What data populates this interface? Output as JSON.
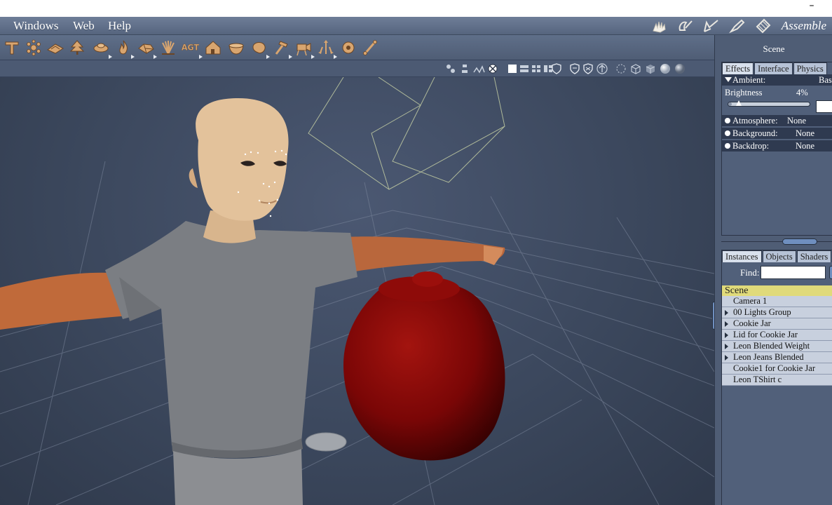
{
  "window": {
    "minimize_glyph": "–"
  },
  "menubar": {
    "items": [
      {
        "label": "Windows"
      },
      {
        "label": "Web"
      },
      {
        "label": "Help"
      }
    ],
    "rooms": {
      "icons": [
        "hand-icon",
        "face-brush-icon",
        "pen-icon",
        "pen-nib-icon",
        "material-room-icon"
      ],
      "current_label": "Assemble"
    }
  },
  "toolbar": {
    "tools": [
      {
        "icon": "text-tool-icon",
        "has_menu": false
      },
      {
        "icon": "sparkle-tool-icon",
        "has_menu": false
      },
      {
        "icon": "terrain-tool-icon",
        "has_menu": false
      },
      {
        "icon": "tree-tool-icon",
        "has_menu": false
      },
      {
        "icon": "cloud-tool-icon",
        "has_menu": true
      },
      {
        "icon": "fire-tool-icon",
        "has_menu": true
      },
      {
        "icon": "rock-tool-icon",
        "has_menu": true
      },
      {
        "icon": "plant-tool-icon",
        "has_menu": false
      },
      {
        "icon": "agt-tool-icon",
        "label": "AGT",
        "has_menu": true
      },
      {
        "icon": "house-tool-icon",
        "has_menu": false
      },
      {
        "icon": "bowl-tool-icon",
        "has_menu": false
      },
      {
        "icon": "blob-tool-icon",
        "has_menu": true
      },
      {
        "icon": "hammer-tool-icon",
        "has_menu": true
      },
      {
        "icon": "camera-tool-icon",
        "has_menu": true
      },
      {
        "icon": "arrows-tool-icon",
        "has_menu": true
      },
      {
        "icon": "target-tool-icon",
        "has_menu": false
      },
      {
        "icon": "bone-tool-icon",
        "has_menu": false
      }
    ]
  },
  "viewport_header": {
    "icons": [
      "snap-icon",
      "align-icon",
      "group-icon",
      "light-icon",
      "single-view-icon",
      "two-view-icon",
      "quad-view-icon",
      "split-view-icon",
      "shield-icon",
      "shield-outline-icon",
      "shield-fill-icon",
      "up-arrow-icon",
      "move-icon",
      "cube-wire-icon",
      "cube-solid-icon",
      "sphere-white-icon",
      "sphere-gray-icon"
    ]
  },
  "right_panel": {
    "title": "Scene",
    "tabs": [
      "Effects",
      "Interface",
      "Physics"
    ],
    "ambient": {
      "label": "Ambient:",
      "value": "Bas"
    },
    "brightness": {
      "label": "Brightness",
      "value": "4%",
      "fraction": 0.04
    },
    "rows": [
      {
        "label": "Atmosphere:",
        "value": "None"
      },
      {
        "label": "Background:",
        "value": "None"
      },
      {
        "label": "Backdrop:",
        "value": "None"
      }
    ],
    "lower_tabs": [
      "Instances",
      "Objects",
      "Shaders",
      "S"
    ],
    "find": {
      "label": "Find:",
      "value": ""
    },
    "scene_header": "Scene",
    "instances": [
      {
        "name": "Camera 1",
        "expandable": false
      },
      {
        "name": "00 Lights Group",
        "expandable": true
      },
      {
        "name": "Cookie Jar",
        "expandable": true
      },
      {
        "name": "Lid for Cookie Jar",
        "expandable": true
      },
      {
        "name": "Leon Blended Weight",
        "expandable": true
      },
      {
        "name": "Leon Jeans Blended",
        "expandable": true
      },
      {
        "name": "Cookie1 for Cookie Jar",
        "expandable": false
      },
      {
        "name": "Leon TShirt c",
        "expandable": false
      }
    ]
  },
  "colors": {
    "panel": "#4f5d75",
    "jar": "#8a0a0a",
    "shirt": "#7b7e83",
    "skin": "#e3c29b",
    "arm": "#c06a3a"
  }
}
